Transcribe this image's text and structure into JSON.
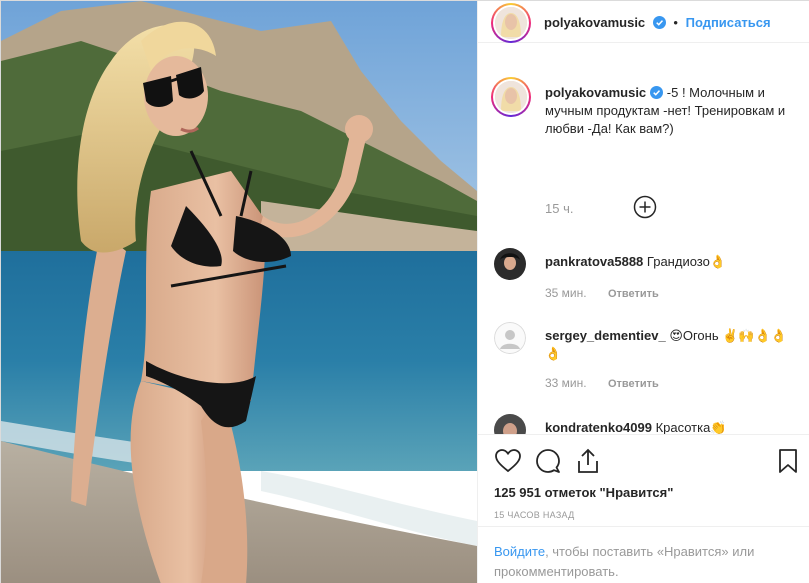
{
  "post": {
    "photo_icon": "beach-bikini-photo"
  },
  "header": {
    "username": "polyakovamusic",
    "verified_icon": "verified-badge-icon",
    "separator": "•",
    "follow_label": "Подписаться"
  },
  "caption": {
    "username": "polyakovamusic",
    "text": "-5 ! Молочным и мучным продуктам -нет! Тренировкам и любви -Да! Как вам?)",
    "time": "15 ч."
  },
  "load_more_icon": "plus-circle-icon",
  "comments": [
    {
      "username": "pankratova5888",
      "text": "Грандиозо👌",
      "time": "35 мин.",
      "reply": "Ответить"
    },
    {
      "username": "sergey_dementiev_",
      "text": "😍Огонь ✌️🙌👌👌👌",
      "time": "33 мин.",
      "reply": "Ответить"
    },
    {
      "username": "kondratenko4099",
      "text": "Красотка👏",
      "time": "",
      "reply": ""
    }
  ],
  "actions": {
    "like_icon": "heart-icon",
    "comment_icon": "comment-icon",
    "share_icon": "share-icon",
    "save_icon": "bookmark-icon",
    "likes_text": "125 951 отметок \"Нравится\"",
    "ago_text": "15 ЧАСОВ НАЗАД"
  },
  "login": {
    "link_text": "Войдите",
    "rest_text": ", чтобы поставить «Нравится» или прокомментировать."
  },
  "colors": {
    "link_blue": "#3897f0",
    "text": "#262626",
    "muted": "#999999",
    "border": "#efefef"
  }
}
